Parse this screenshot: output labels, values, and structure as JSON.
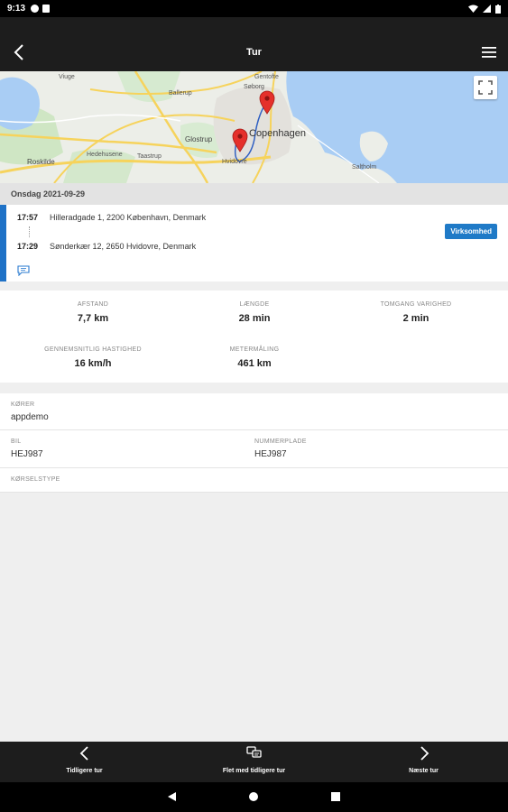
{
  "status_bar": {
    "time": "9:13"
  },
  "header": {
    "title": "Tur",
    "back_icon": "chevron-left-icon",
    "menu_icon": "hamburger-icon"
  },
  "map": {
    "labels": {
      "city": "Copenhagen",
      "roskilde": "Roskilde",
      "glostrup": "Glostrup",
      "hvidovre": "Hvidovre",
      "saltholm": "Saltholm",
      "hedehusene": "Hedehusene",
      "taastrup": "Taastrup",
      "ballerup": "Ballerup",
      "gentofte": "Gentofte",
      "soborg": "Søborg",
      "viuge": "Viuge"
    },
    "fullscreen_icon": "fullscreen-icon"
  },
  "trip": {
    "date": "Onsdag 2021-09-29",
    "start_time": "17:57",
    "start_address": "Hilleradgade 1, 2200 København, Denmark",
    "end_time": "17:29",
    "end_address": "Sønderkær 12, 2650 Hvidovre, Denmark",
    "badge": "Virksomhed",
    "accent_color": "#1f72c7"
  },
  "stats": {
    "distance_label": "AFSTAND",
    "distance_value": "7,7 km",
    "duration_label": "LÆNGDE",
    "duration_value": "28 min",
    "idle_label": "TOMGANG VARIGHED",
    "idle_value": "2 min",
    "avg_speed_label": "GENNEMSNITLIG HASTIGHED",
    "avg_speed_value": "16 km/h",
    "odometer_label": "METERMÅLING",
    "odometer_value": "461 km"
  },
  "details": {
    "driver_label": "KØRER",
    "driver_value": "appdemo",
    "car_label": "BIL",
    "car_value": "HEJ987",
    "plate_label": "NUMMERPLADE",
    "plate_value": "HEJ987",
    "trip_type_label": "KØRSELSTYPE"
  },
  "bottom_nav": {
    "prev_label": "Tidligere tur",
    "merge_label": "Flet med tidligere tur",
    "next_label": "Næste tur"
  }
}
